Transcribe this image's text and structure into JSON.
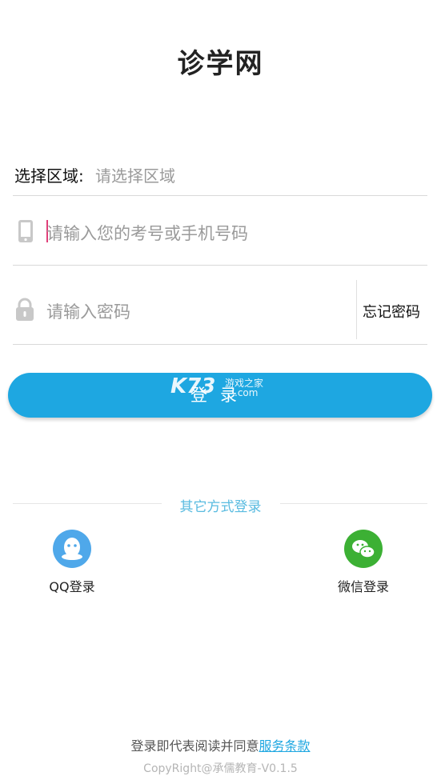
{
  "app": {
    "title": "诊学网"
  },
  "region": {
    "label": "选择区域:",
    "placeholder": "请选择区域"
  },
  "account": {
    "placeholder": "请输入您的考号或手机号码"
  },
  "password": {
    "placeholder": "请输入密码",
    "forgot_label": "忘记密码"
  },
  "login": {
    "label": "登录"
  },
  "watermark": {
    "logo": "K73",
    "name": "游戏之家",
    "domain": ".com"
  },
  "other_login": {
    "label": "其它方式登录",
    "qq": {
      "label": "QQ登录",
      "icon": "qq-icon"
    },
    "wechat": {
      "label": "微信登录",
      "icon": "wechat-icon"
    }
  },
  "footer": {
    "agree_text": "登录即代表阅读并同意",
    "terms_link": "服务条款",
    "copyright": "CopyRight@承儒教育-V0.1.5"
  },
  "colors": {
    "accent": "#1ea7e1",
    "qq": "#4fa8ea",
    "wechat": "#3cb034",
    "link": "#59bbe0"
  }
}
